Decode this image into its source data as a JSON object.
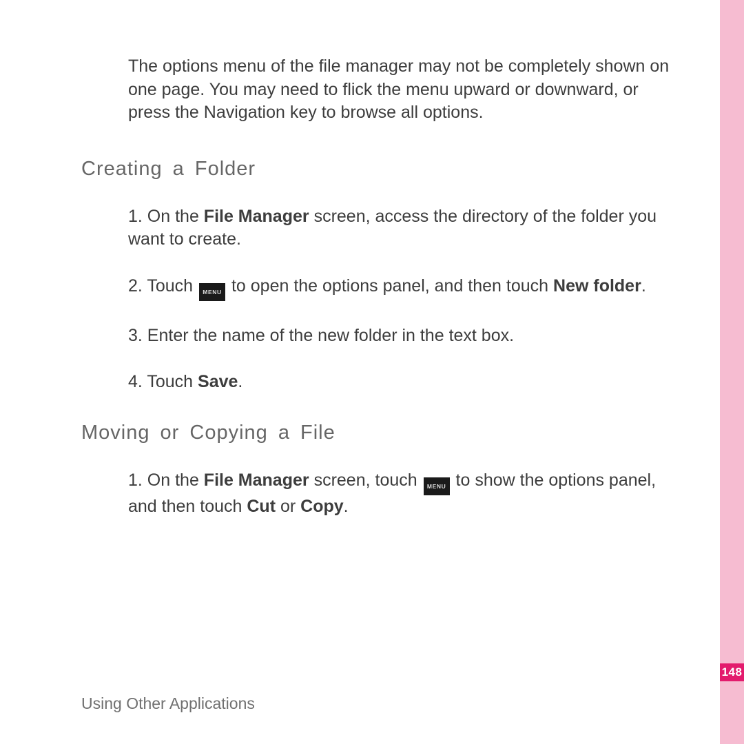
{
  "sidebar": {
    "color_strip": "#f6bcd1",
    "page_number": "148",
    "page_number_bg": "#e31b6d"
  },
  "intro_paragraph": "The options menu of the file manager may not be completely shown on one page. You may need to flick the menu upward or downward, or press the Navigation key to browse all options.",
  "section_creating": {
    "heading": "Creating a Folder",
    "steps": {
      "s1_prefix": "1. On the ",
      "s1_bold1": "File Manager",
      "s1_suffix": " screen, access the directory of the folder you want to create.",
      "s2_prefix": "2. Touch ",
      "s2_menu_label": "MENU",
      "s2_mid": " to open the options panel, and then touch ",
      "s2_bold": "New folder",
      "s2_end": ".",
      "s3": "3. Enter the name of the new folder in the text box.",
      "s4_prefix": "4. Touch ",
      "s4_bold": "Save",
      "s4_end": "."
    }
  },
  "section_moving": {
    "heading": "Moving or Copying a File",
    "steps": {
      "s1_prefix": "1. On the ",
      "s1_bold1": "File Manager",
      "s1_mid1": " screen, touch ",
      "s1_menu_label": "MENU",
      "s1_mid2": " to show the options panel, and then touch ",
      "s1_bold2": "Cut",
      "s1_or": " or ",
      "s1_bold3": "Copy",
      "s1_end": "."
    }
  },
  "footer": "Using Other Applications"
}
